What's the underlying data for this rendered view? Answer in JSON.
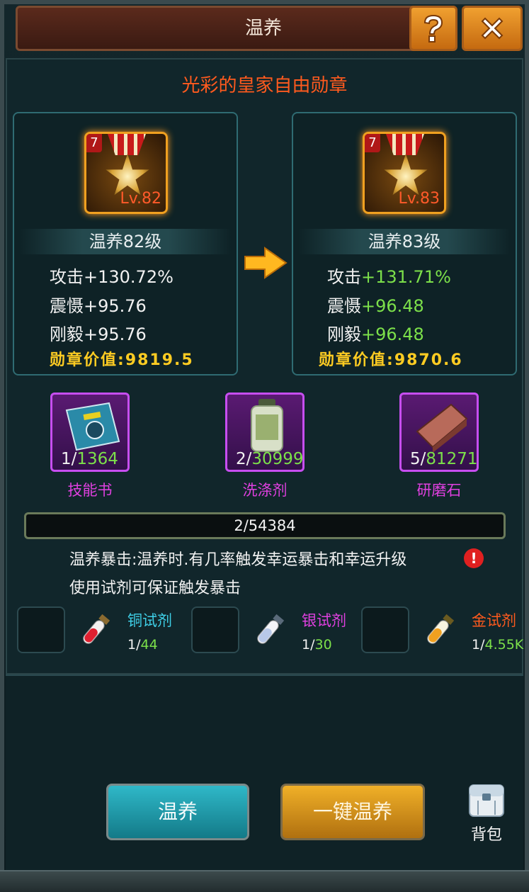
{
  "header": {
    "title": "温养"
  },
  "item": {
    "name": "光彩的皇家自由勋章"
  },
  "current": {
    "badge": "7",
    "medal_level": "Lv.82",
    "level_text": "温养82级",
    "stats": [
      {
        "label": "攻击",
        "value": "+130.72%"
      },
      {
        "label": "震慑",
        "value": "+95.76"
      },
      {
        "label": "刚毅",
        "value": "+95.76"
      }
    ],
    "value_label": "勋章价值:",
    "value": "9819.5"
  },
  "next": {
    "badge": "7",
    "medal_level": "Lv.83",
    "level_text": "温养83级",
    "stats": [
      {
        "label": "攻击",
        "value": "+131.71%"
      },
      {
        "label": "震慑",
        "value": "+96.48"
      },
      {
        "label": "刚毅",
        "value": "+96.48"
      }
    ],
    "value_label": "勋章价值:",
    "value": "9870.6"
  },
  "materials": [
    {
      "name": "技能书",
      "have": "1/",
      "need": "1364"
    },
    {
      "name": "洗涤剂",
      "have": "2/",
      "need": "30999"
    },
    {
      "name": "研磨石",
      "have": "5/",
      "need": "81271"
    }
  ],
  "progress": {
    "text": "2/54384",
    "fraction": 4e-05
  },
  "description": {
    "line1": "温养暴击:温养时.有几率触发幸运暴击和幸运升级",
    "line2": "使用试剂可保证触发暴击"
  },
  "potions": [
    {
      "name": "铜试剂",
      "have": "1/",
      "count": "44",
      "color": "#3fd0e8"
    },
    {
      "name": "银试剂",
      "have": "1/",
      "count": "30",
      "color": "#e040e0"
    },
    {
      "name": "金试剂",
      "have": "1/",
      "count": "4.55K",
      "color": "#ff5a1e"
    }
  ],
  "buttons": {
    "foster": "温养",
    "quick": "一键温养",
    "bag": "背包"
  },
  "colors": {
    "accent_orange": "#ff5a1e",
    "value_gold": "#ffcc22",
    "stat_green": "#7ce04a",
    "material_purple": "#c74ef0"
  }
}
